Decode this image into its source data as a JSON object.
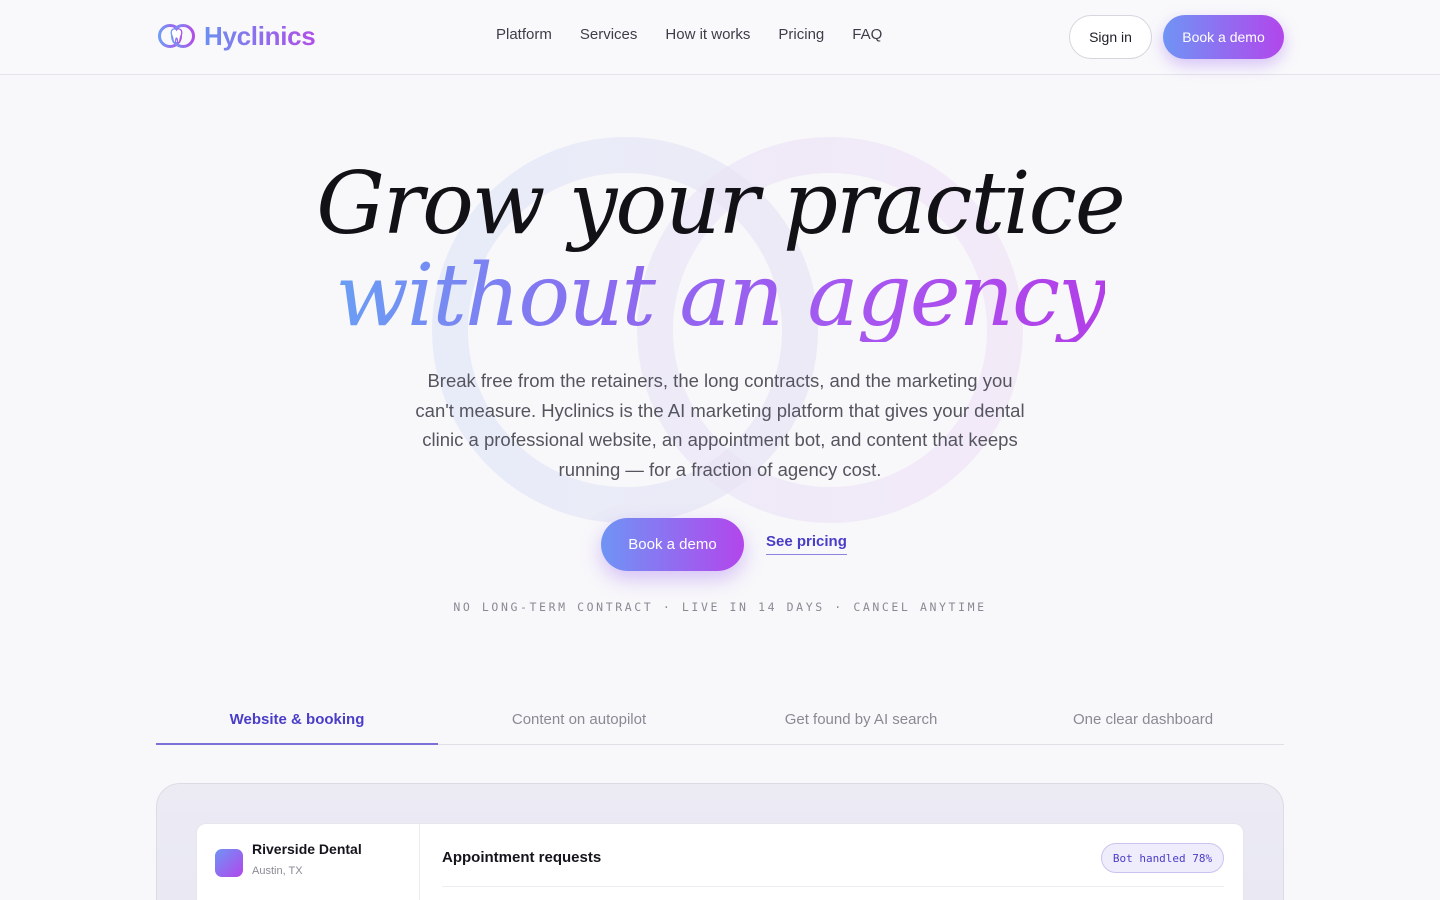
{
  "nav": {
    "brand": "Hyclinics",
    "links": [
      "Platform",
      "Services",
      "How it works",
      "Pricing",
      "FAQ"
    ],
    "sign_in": "Sign in",
    "book_demo": "Book a demo"
  },
  "hero": {
    "headline_line1": "Grow your practice",
    "headline_line2": "without an agency",
    "subtitle": "Break free from the retainers, the long contracts, and the marketing you can't measure. Hyclinics is the AI marketing platform that gives your dental clinic a professional website, an appointment bot, and content that keeps running — for a fraction of agency cost.",
    "cta_primary": "Book a demo",
    "cta_secondary": "See pricing",
    "fineprint": "NO LONG-TERM CONTRACT · LIVE IN 14 DAYS · CANCEL ANYTIME"
  },
  "tabs": [
    {
      "label": "Website & booking",
      "active": true
    },
    {
      "label": "Content on autopilot",
      "active": false
    },
    {
      "label": "Get found by AI search",
      "active": false
    },
    {
      "label": "One clear dashboard",
      "active": false
    }
  ],
  "preview": {
    "clinic_name": "Riverside Dental",
    "clinic_location": "Austin, TX",
    "panel_title": "Appointment requests",
    "badge": "Bot handled 78%"
  },
  "colors": {
    "accent_start": "#6f94f5",
    "accent_end": "#b246ec",
    "link": "#4a3dc8"
  }
}
